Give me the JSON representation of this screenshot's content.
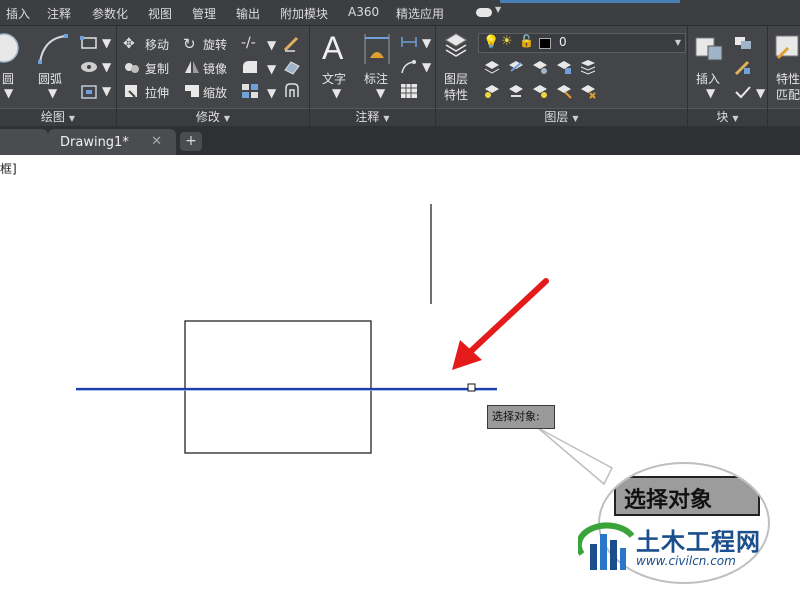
{
  "menu": [
    "插入",
    "注释",
    "参数化",
    "视图",
    "管理",
    "输出",
    "附加模块",
    "A360",
    "精选应用"
  ],
  "ribbon": {
    "draw": {
      "footer": "绘图",
      "circle_label": "圆",
      "arc_label": "圆弧"
    },
    "modify": {
      "footer": "修改",
      "move": "移动",
      "rotate": "旋转",
      "copy": "复制",
      "mirror": "镜像",
      "stretch": "拉伸",
      "scale": "缩放"
    },
    "annotation": {
      "footer": "注释",
      "text": "文字",
      "dimension": "标注"
    },
    "layers": {
      "footer": "图层",
      "layer_properties_line1": "图层",
      "layer_properties_line2": "特性",
      "current_layer": "0"
    },
    "block": {
      "footer": "块",
      "insert": "插入"
    },
    "properties": {
      "line1": "特性",
      "line2": "匹配"
    }
  },
  "tabs": {
    "active_title": "Drawing1*",
    "close_glyph": "✕",
    "add_glyph": "+"
  },
  "viewport": {
    "label": "框]"
  },
  "prompt": {
    "tooltip": "选择对象:",
    "magnified": "选择对象"
  },
  "watermark": {
    "name": "土木工程网",
    "url": "www.civilcn.com"
  },
  "colors": {
    "selected_line": "#1f3fa8",
    "arrow": "#e31b1b"
  }
}
